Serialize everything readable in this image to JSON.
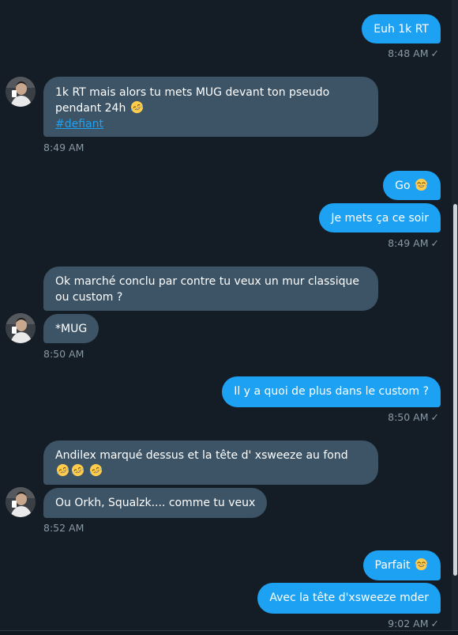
{
  "conversation": {
    "messages": [
      {
        "id": "m1",
        "dir": "out",
        "text": "Euh 1k RT"
      },
      {
        "id": "m2",
        "dir": "in",
        "text": "1k RT mais alors tu mets MUG devant ton pseudo pendant 24h",
        "emoji": "rofl-emoji",
        "hashtag": "#defiant"
      },
      {
        "id": "m3",
        "dir": "out",
        "text": "Go",
        "emoji": "tears-of-joy-emoji"
      },
      {
        "id": "m4",
        "dir": "out",
        "text": "Je mets ça ce soir"
      },
      {
        "id": "m5",
        "dir": "in",
        "text": "Ok marché conclu par contre tu veux un mur classique ou custom ?"
      },
      {
        "id": "m6",
        "dir": "in",
        "text": "*MUG"
      },
      {
        "id": "m7",
        "dir": "out",
        "text": "Il y a quoi de plus dans le custom ?"
      },
      {
        "id": "m8",
        "dir": "in",
        "text": "Andilex marqué dessus et la tête d' xsweeze au fond",
        "emoji": "rofl-emoji"
      },
      {
        "id": "m9",
        "dir": "in",
        "text": "Ou Orkh, Squalzk.... comme tu veux"
      },
      {
        "id": "m10",
        "dir": "out",
        "text": "Parfait",
        "emoji": "tears-of-joy-emoji"
      },
      {
        "id": "m11",
        "dir": "out",
        "text": "Avec la tête d'xsweeze mder"
      }
    ],
    "timestamps": {
      "t1": "8:48 AM",
      "t2": "8:49 AM",
      "t3": "8:49 AM",
      "t4": "8:50 AM",
      "t5": "8:50 AM",
      "t6": "8:52 AM",
      "t7": "9:02 AM"
    },
    "read_check": "✓"
  },
  "colors": {
    "background": "#141d26",
    "outgoing_bubble": "#1da1f2",
    "incoming_bubble": "#3d5466",
    "timestamp": "#8899a6",
    "hashtag": "#1da1f2"
  },
  "icons": {
    "avatar": "user-avatar",
    "read_receipt": "checkmark-icon"
  }
}
